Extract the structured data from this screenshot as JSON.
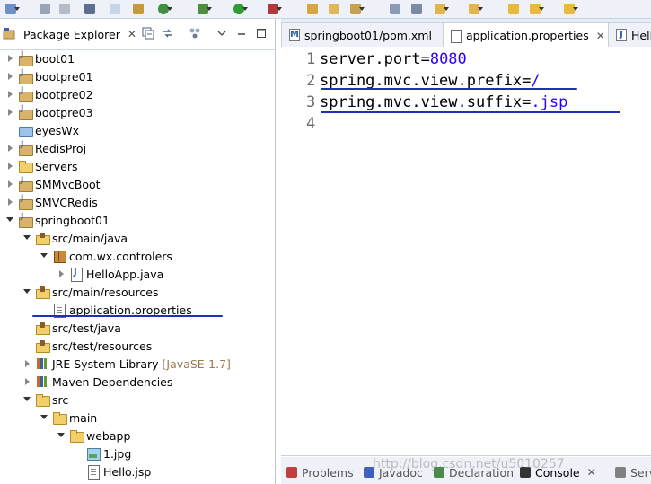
{
  "toolbar": {
    "icons": [
      "new-icon",
      "save-icon",
      "save-all-icon",
      "print-icon",
      "search-icon",
      "run-debug-icon",
      "build-icon",
      "run-icon",
      "stop-icon",
      "open-type-icon",
      "open-folder-icon",
      "edit-icon",
      "list-icon",
      "structure-icon",
      "nav-down-icon",
      "nav-up-icon",
      "back-icon",
      "forward-icon"
    ]
  },
  "explorer": {
    "title": "Package Explorer",
    "close": "✕",
    "tree": [
      {
        "label": "boot01",
        "icon": "project",
        "arrow": "collapsed",
        "level": 0
      },
      {
        "label": "bootpre01",
        "icon": "project",
        "arrow": "collapsed",
        "level": 0
      },
      {
        "label": "bootpre02",
        "icon": "project",
        "arrow": "collapsed",
        "level": 0
      },
      {
        "label": "bootpre03",
        "icon": "project",
        "arrow": "collapsed",
        "level": 0
      },
      {
        "label": "eyesWx",
        "icon": "blue-folder",
        "arrow": "none",
        "level": 0
      },
      {
        "label": "RedisProj",
        "icon": "project",
        "arrow": "collapsed",
        "level": 0
      },
      {
        "label": "Servers",
        "icon": "folder",
        "arrow": "collapsed",
        "level": 0
      },
      {
        "label": "SMMvcBoot",
        "icon": "project",
        "arrow": "collapsed",
        "level": 0
      },
      {
        "label": "SMVCRedis",
        "icon": "project",
        "arrow": "collapsed",
        "level": 0
      },
      {
        "label": "springboot01",
        "icon": "project",
        "arrow": "expanded",
        "level": 0
      },
      {
        "label": "src/main/java",
        "icon": "source-folder",
        "arrow": "expanded",
        "level": 1
      },
      {
        "label": "com.wx.controlers",
        "icon": "package",
        "arrow": "expanded",
        "level": 2
      },
      {
        "label": "HelloApp.java",
        "icon": "java-file",
        "arrow": "collapsed",
        "level": 3
      },
      {
        "label": "src/main/resources",
        "icon": "source-folder",
        "arrow": "expanded",
        "level": 1
      },
      {
        "label": "application.properties",
        "icon": "file",
        "arrow": "none",
        "level": 2
      },
      {
        "label": "src/test/java",
        "icon": "source-folder",
        "arrow": "none",
        "level": 1
      },
      {
        "label": "src/test/resources",
        "icon": "source-folder",
        "arrow": "none",
        "level": 1
      },
      {
        "label": "JRE System Library",
        "suffix": "[JavaSE-1.7]",
        "icon": "library",
        "arrow": "collapsed",
        "level": 1
      },
      {
        "label": "Maven Dependencies",
        "icon": "library",
        "arrow": "collapsed",
        "level": 1
      },
      {
        "label": "src",
        "icon": "folder",
        "arrow": "expanded",
        "level": 1
      },
      {
        "label": "main",
        "icon": "folder",
        "arrow": "expanded",
        "level": 2
      },
      {
        "label": "webapp",
        "icon": "folder",
        "arrow": "expanded",
        "level": 3
      },
      {
        "label": "1.jpg",
        "icon": "image",
        "arrow": "none",
        "level": 4
      },
      {
        "label": "Hello.jsp",
        "icon": "file",
        "arrow": "none",
        "level": 4
      }
    ]
  },
  "editor": {
    "tabs": [
      {
        "label": "springboot01/pom.xml",
        "icon": "maven-icon",
        "active": false
      },
      {
        "label": "application.properties",
        "icon": "properties-file-icon",
        "active": true,
        "close": "✕"
      },
      {
        "label": "Hello",
        "icon": "java-file-icon",
        "active": false
      }
    ],
    "lines": [
      {
        "num": "1",
        "key": "server.port=",
        "value": "8080"
      },
      {
        "num": "2",
        "key": "spring.mvc.view.prefix=",
        "value": "/"
      },
      {
        "num": "3",
        "key": "spring.mvc.view.suffix=",
        "value": ".jsp"
      },
      {
        "num": "4",
        "key": "",
        "value": ""
      }
    ]
  },
  "bottom_tabs": [
    {
      "label": "Problems",
      "icon_color": "#c04040",
      "active": false
    },
    {
      "label": "Javadoc",
      "icon_color": "#4060c0",
      "active": false
    },
    {
      "label": "Declaration",
      "icon_color": "#4a8a4a",
      "active": false
    },
    {
      "label": "Console",
      "icon_color": "#333333",
      "active": true,
      "close": "✕"
    },
    {
      "label": "Serve",
      "icon_color": "#808080",
      "active": false
    }
  ],
  "watermark": "http://blog.csdn.net/u5010257"
}
